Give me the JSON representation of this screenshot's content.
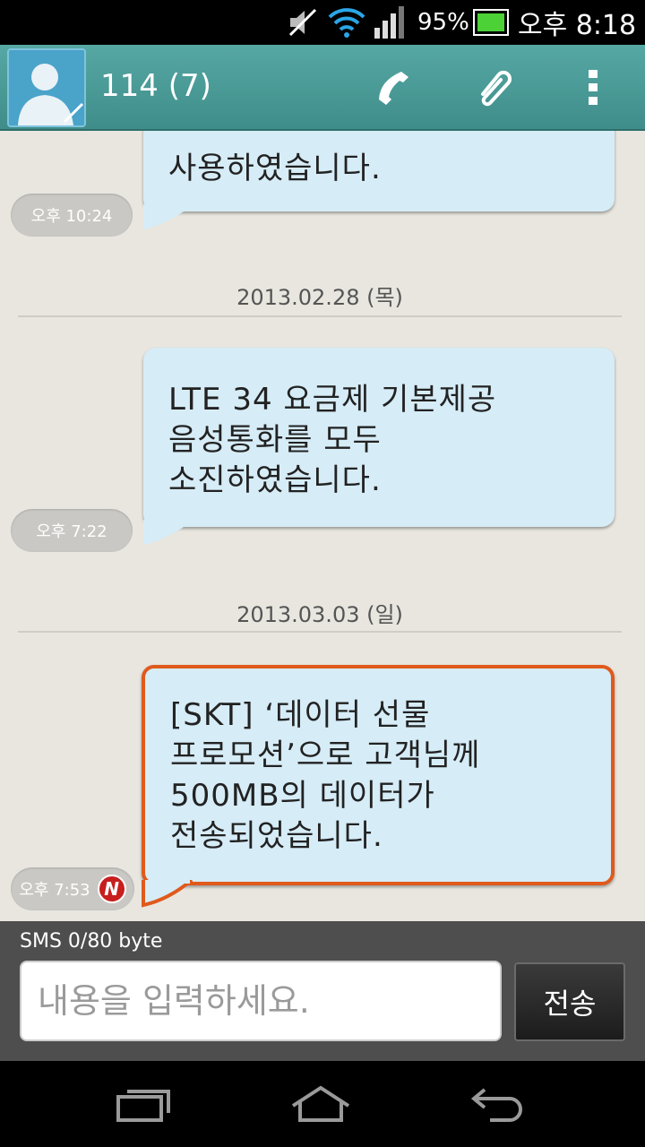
{
  "status_bar": {
    "battery_percent": "95%",
    "time": "오후 8:18",
    "icons": [
      "mute-icon",
      "wifi-icon",
      "signal-icon",
      "battery-icon"
    ]
  },
  "header": {
    "contact_title": "114 (7)",
    "icons": [
      "avatar-icon",
      "phone-icon",
      "paperclip-icon",
      "overflow-menu-icon"
    ]
  },
  "messages": [
    {
      "text": "사용하였습니다.",
      "time": "오후 10:24"
    },
    {
      "date": "2013.02.28 (목)"
    },
    {
      "text": "LTE 34 요금제 기본제공\n음성통화를 모두\n소진하였습니다.",
      "time": "오후 7:22"
    },
    {
      "date": "2013.03.03 (일)"
    },
    {
      "text": "[SKT] ‘데이터 선물\n프로모션’으로 고객님께\n500MB의 데이터가\n전송되었습니다.",
      "time": "오후 7:53",
      "badge": "N"
    }
  ],
  "compose": {
    "counter": "SMS  0/80 byte",
    "placeholder": "내용을 입력하세요.",
    "send_label": "전송"
  },
  "nav": {
    "icons": [
      "recent-apps-icon",
      "home-icon",
      "back-icon"
    ]
  },
  "colors": {
    "header": "#4a9a96",
    "bubble": "#d6ecf7",
    "highlight_border": "#e05a1c",
    "conversation_bg": "#e8e6df"
  }
}
